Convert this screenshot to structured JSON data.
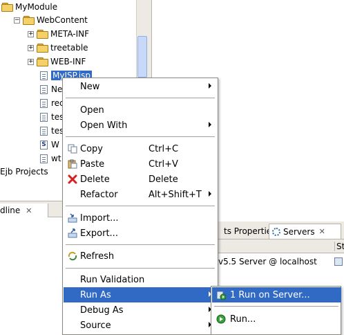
{
  "explorer": {
    "tree": [
      {
        "label": "MyModule",
        "kind": "folder",
        "expander": "",
        "selected": false
      },
      {
        "label": "WebContent",
        "kind": "folder",
        "expander": "−",
        "selected": false
      },
      {
        "label": "META-INF",
        "kind": "folder",
        "expander": "+",
        "selected": false
      },
      {
        "label": "treetable",
        "kind": "folder",
        "expander": "+",
        "selected": false
      },
      {
        "label": "WEB-INF",
        "kind": "folder",
        "expander": "+",
        "selected": false
      },
      {
        "label": "MyJSP.jsp",
        "kind": "file",
        "expander": "",
        "selected": true
      },
      {
        "label": "Ne",
        "kind": "file",
        "expander": "",
        "selected": false
      },
      {
        "label": "rec",
        "kind": "file",
        "expander": "",
        "selected": false
      },
      {
        "label": "tes",
        "kind": "file",
        "expander": "",
        "selected": false
      },
      {
        "label": "tes",
        "kind": "file",
        "expander": "",
        "selected": false
      },
      {
        "label": "W",
        "kind": "file-s",
        "expander": "",
        "selected": false
      },
      {
        "label": "wt",
        "kind": "file",
        "expander": "",
        "selected": false
      }
    ],
    "ejb_projects": "Ejb Projects"
  },
  "outline": {
    "tab_label": "dline",
    "close": "✕"
  },
  "servers_view": {
    "tabs": [
      "ts Properties",
      "Servers"
    ],
    "close": "✕",
    "column_status": "St",
    "server_name": "v5.5 Server @ localhost"
  },
  "context_menu": {
    "items": {
      "new": "New",
      "open": "Open",
      "open_with": "Open With",
      "copy": "Copy",
      "copy_shortcut": "Ctrl+C",
      "paste": "Paste",
      "paste_shortcut": "Ctrl+V",
      "delete": "Delete",
      "delete_shortcut": "Delete",
      "refactor": "Refactor",
      "refactor_shortcut": "Alt+Shift+T",
      "import": "Import...",
      "export": "Export...",
      "refresh": "Refresh",
      "run_validation": "Run Validation",
      "run_as": "Run As",
      "debug_as": "Debug As",
      "source": "Source"
    },
    "highlighted": "Run As"
  },
  "submenu": {
    "run_on_server": "1 Run on Server...",
    "run": "Run..."
  },
  "colors": {
    "selection": "#316ac5",
    "menu_border": "#8a8780",
    "panel_bg": "#eceae3",
    "folder": "#f5d169"
  },
  "icons": {
    "copy": "copy-icon",
    "paste": "paste-icon",
    "delete": "delete-icon",
    "import": "import-icon",
    "export": "export-icon",
    "refresh": "refresh-icon",
    "run_on_server": "run-on-server-icon",
    "run": "run-icon"
  }
}
